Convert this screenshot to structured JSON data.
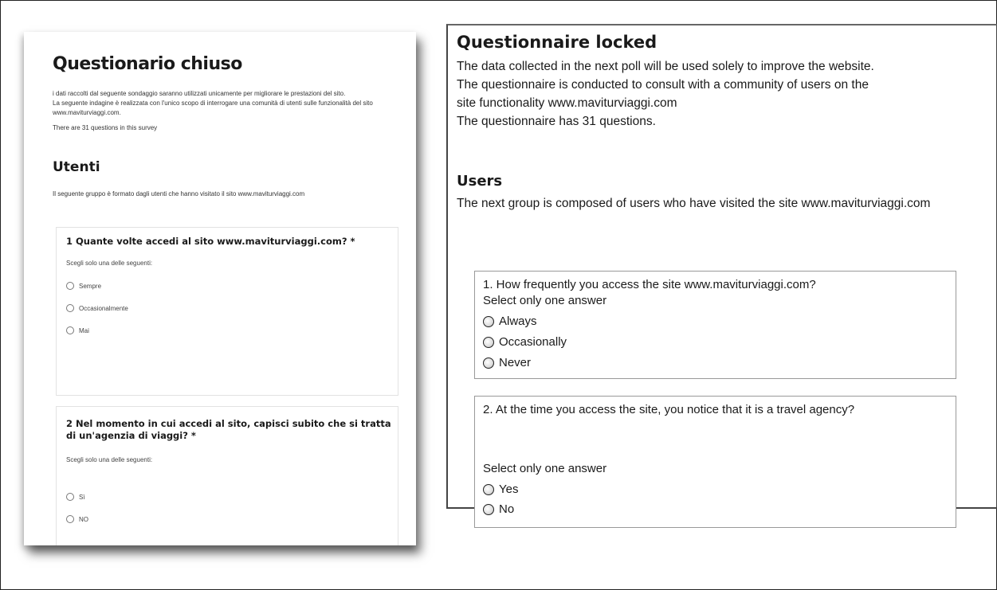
{
  "italian_page": {
    "title": "Questionario chiuso",
    "description_lines": [
      "i dati raccolti dal seguente sondaggio saranno utilizzati unicamente per migliorare le prestazioni del sito.",
      "La seguente indagine è realizzata con l'unico scopo di interrogare una comunità di utenti sulle funzionalità del sito",
      "www.maviturviaggi.com."
    ],
    "question_count": "There are 31 questions in this survey",
    "section_title": "Utenti",
    "section_description": "Il seguente gruppo è formato dagli utenti che hanno visitato il sito www.maviturviaggi.com",
    "questions": [
      {
        "title": "1 Quante volte accedi al sito www.maviturviaggi.com? *",
        "hint": "Scegli solo una delle seguenti:",
        "options": [
          "Sempre",
          "Occasionalmente",
          "Mai"
        ]
      },
      {
        "title": "2 Nel momento in cui accedi al sito, capisci subito che si tratta di un'agenzia di viaggi? *",
        "hint": "Scegli solo una delle seguenti:",
        "options": [
          "Sì",
          "NO"
        ]
      }
    ]
  },
  "english_panel": {
    "title": "Questionnaire locked",
    "description_lines": [
      "The data collected in the next poll will be used solely to improve the website.",
      "The questionnaire is conducted to consult with a community of users on the",
      "site functionality www.maviturviaggi.com",
      "The questionnaire has 31 questions."
    ],
    "section_title": "Users",
    "section_description": "The next group is composed of users who have visited the site www.maviturviaggi.com",
    "questions": [
      {
        "title": "1. How frequently you access the site www.maviturviaggi.com?",
        "hint": "Select only one answer",
        "options": [
          "Always",
          "Occasionally",
          "Never"
        ]
      },
      {
        "title": "2. At the time you access the site, you notice that it is a travel agency?",
        "hint": "Select only one answer",
        "options": [
          "Yes",
          "No"
        ]
      }
    ]
  }
}
